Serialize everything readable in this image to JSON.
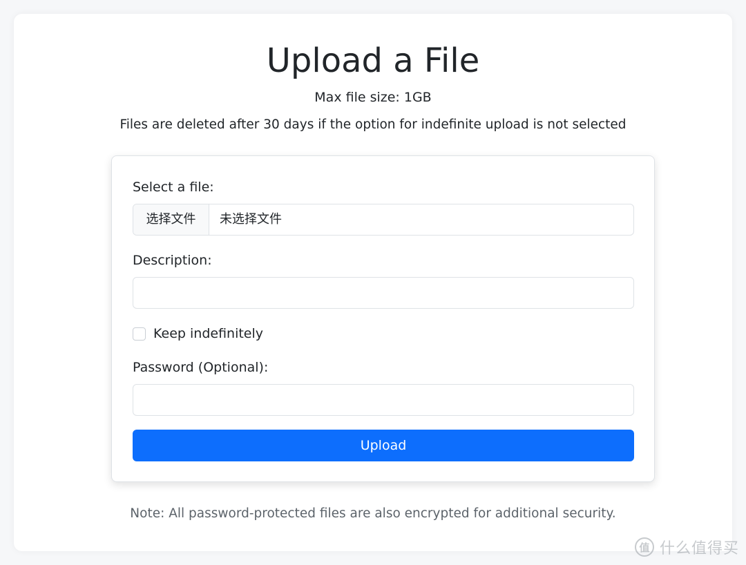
{
  "page": {
    "title": "Upload a File",
    "max_size": "Max file size: 1GB",
    "retention": "Files are deleted after 30 days if the option for indefinite upload is not selected",
    "note": "Note: All password-protected files are also encrypted for additional security."
  },
  "form": {
    "file_label": "Select a file:",
    "file_button": "选择文件",
    "file_status": "未选择文件",
    "description_label": "Description:",
    "description_value": "",
    "keep_label": "Keep indefinitely",
    "keep_checked": false,
    "password_label": "Password (Optional):",
    "password_value": "",
    "submit_label": "Upload"
  },
  "colors": {
    "primary": "#0d6efd",
    "border": "#dee2e6"
  },
  "watermark": {
    "logo_glyph": "值",
    "text": "什么值得买"
  }
}
